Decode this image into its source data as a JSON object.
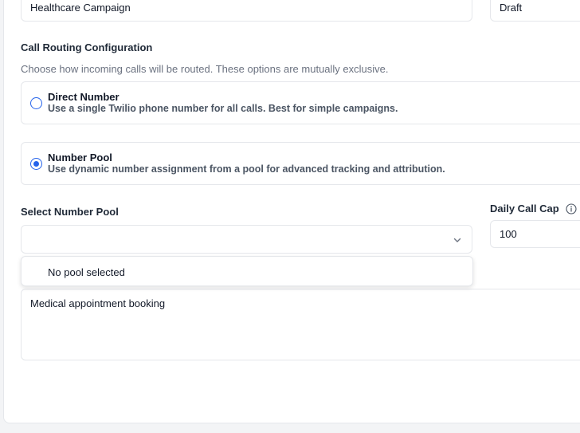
{
  "campaign": {
    "name_value": "Healthcare Campaign",
    "status_value": "Draft"
  },
  "routing": {
    "title": "Call Routing Configuration",
    "helper": "Choose how incoming calls will be routed. These options are mutually exclusive.",
    "options": [
      {
        "title": "Direct Number",
        "description": "Use a single Twilio phone number for all calls. Best for simple campaigns.",
        "selected": false
      },
      {
        "title": "Number Pool",
        "description": "Use dynamic number assignment from a pool for advanced tracking and attribution.",
        "selected": true
      }
    ]
  },
  "number_pool": {
    "label": "Select Number Pool",
    "value": "",
    "dropdown_items": [
      "No pool selected"
    ]
  },
  "daily_cap": {
    "label": "Daily Call Cap",
    "value": "100",
    "info_icon": "info-circle-icon"
  },
  "description": {
    "value": "Medical appointment booking"
  },
  "colors": {
    "accent": "#2563eb",
    "border": "#e5e7eb",
    "muted_text": "#6b7280"
  }
}
